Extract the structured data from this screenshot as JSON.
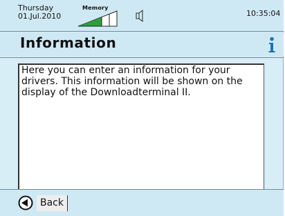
{
  "status": {
    "day": "Thursday",
    "date": "01.Jul.2010",
    "memory_label": "Memory",
    "time": "10:35:04"
  },
  "header": {
    "title": "Information"
  },
  "content": {
    "message": "Here you can enter an information for your drivers. This information will be shown on the display of the Downloadterminal II."
  },
  "footer": {
    "back_label": "Back"
  },
  "colors": {
    "background": "#d8eef7",
    "accent": "#1a73b8",
    "memory_bar": "#2e9e3c"
  }
}
